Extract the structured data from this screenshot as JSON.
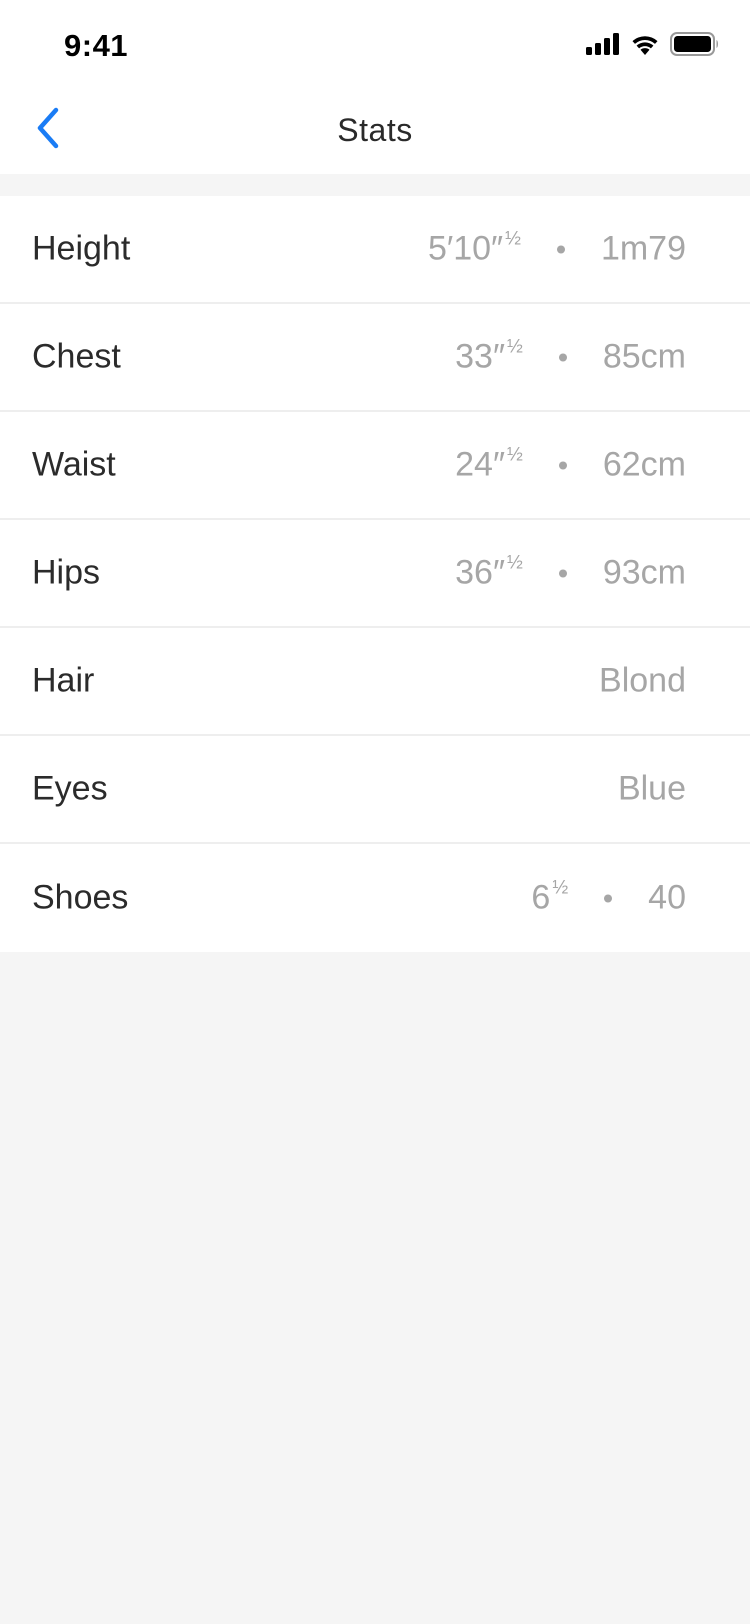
{
  "status_bar": {
    "time": "9:41",
    "icons": [
      "signal-icon",
      "wifi-icon",
      "battery-icon"
    ]
  },
  "nav": {
    "title": "Stats",
    "back_icon": "chevron-left-icon",
    "accent_color": "#1a7cf5"
  },
  "stats": [
    {
      "label": "Height",
      "imperial": "5′10″",
      "imperial_fraction": "½",
      "metric": "1m79"
    },
    {
      "label": "Chest",
      "imperial": "33″",
      "imperial_fraction": "½",
      "metric": "85cm"
    },
    {
      "label": "Waist",
      "imperial": "24″",
      "imperial_fraction": "½",
      "metric": "62cm"
    },
    {
      "label": "Hips",
      "imperial": "36″",
      "imperial_fraction": "½",
      "metric": "93cm"
    },
    {
      "label": "Hair",
      "value": "Blond"
    },
    {
      "label": "Eyes",
      "value": "Blue"
    },
    {
      "label": "Shoes",
      "imperial": "6",
      "imperial_fraction": "½",
      "metric": "40"
    }
  ]
}
